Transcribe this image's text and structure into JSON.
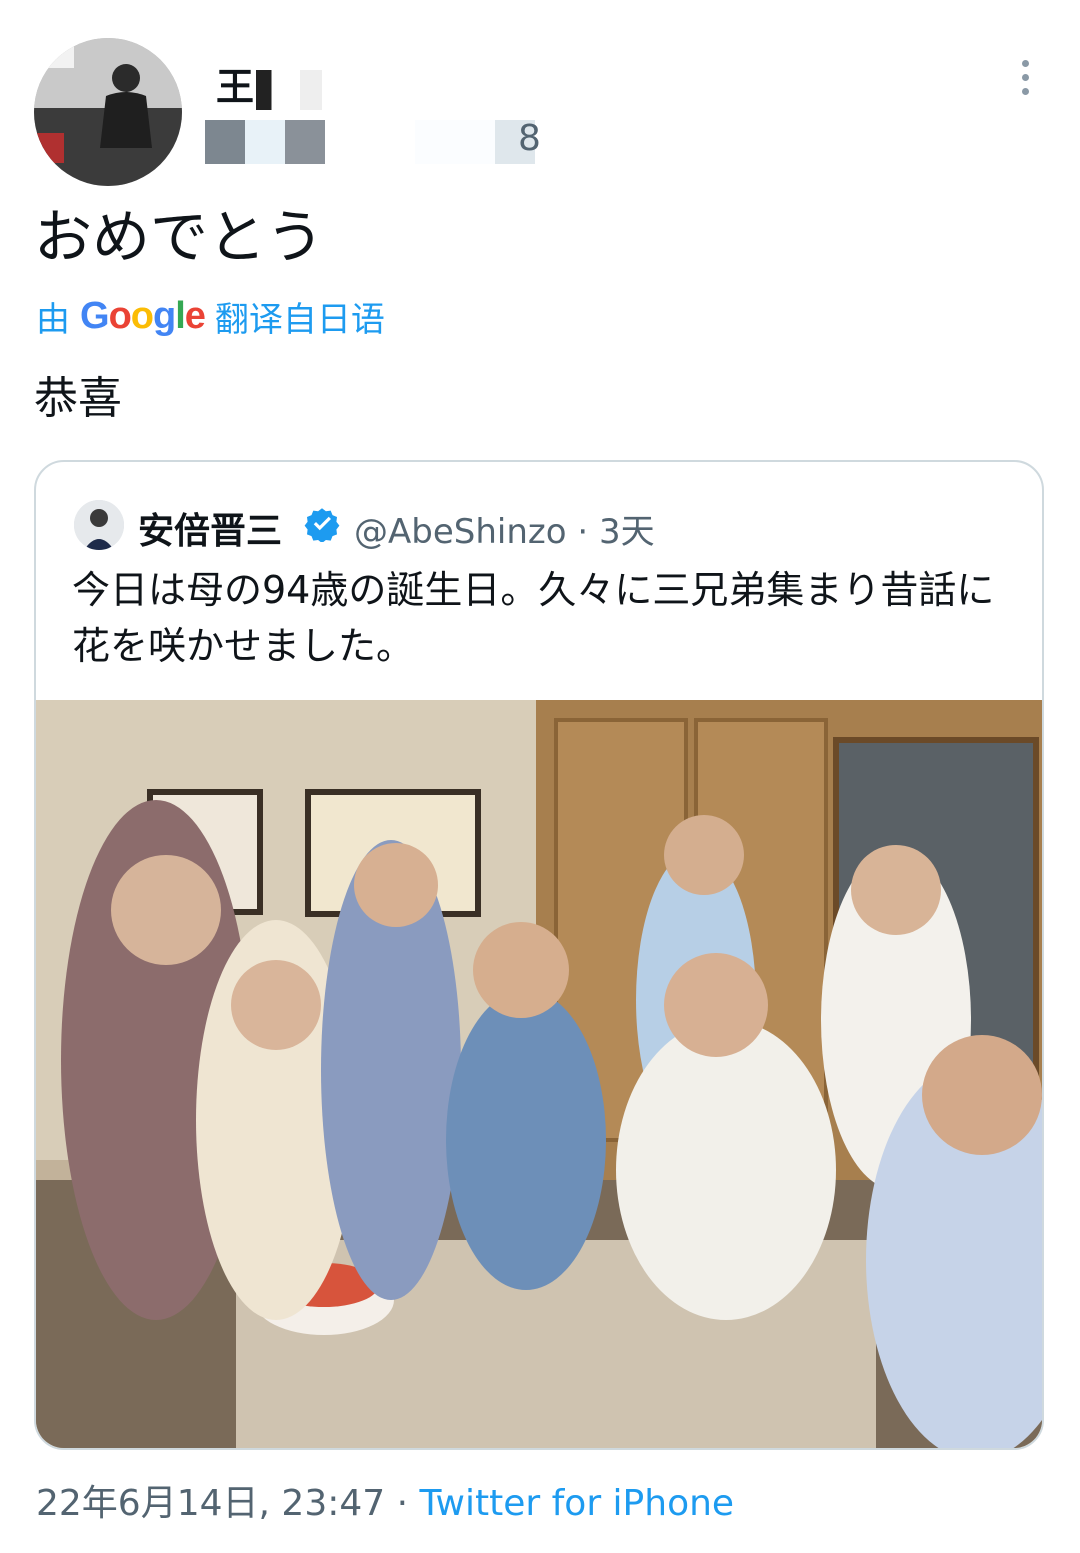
{
  "author": {
    "name": "王",
    "handle_suffix": "8"
  },
  "tweet": {
    "text": "おめでとう",
    "translation_prefix": "由",
    "translation_suffix": "翻译自日语",
    "translated_text": "恭喜"
  },
  "quoted_tweet": {
    "name": "安倍晋三",
    "handle": "@AbeShinzo",
    "separator": "·",
    "time": "3天",
    "text": "今日は母の94歳の誕生日。久々に三兄弟集まり昔話に花を咲かせました。"
  },
  "footer": {
    "timestamp": "22年6月14日, 23:47",
    "separator": "·",
    "source": "Twitter for iPhone"
  },
  "colors": {
    "link": "#1d9bf0",
    "secondary_text": "#536471",
    "border": "#cfd9de"
  },
  "icons": {
    "more": "more-vertical-icon",
    "verified": "verified-badge-icon",
    "google": "google-logo"
  }
}
